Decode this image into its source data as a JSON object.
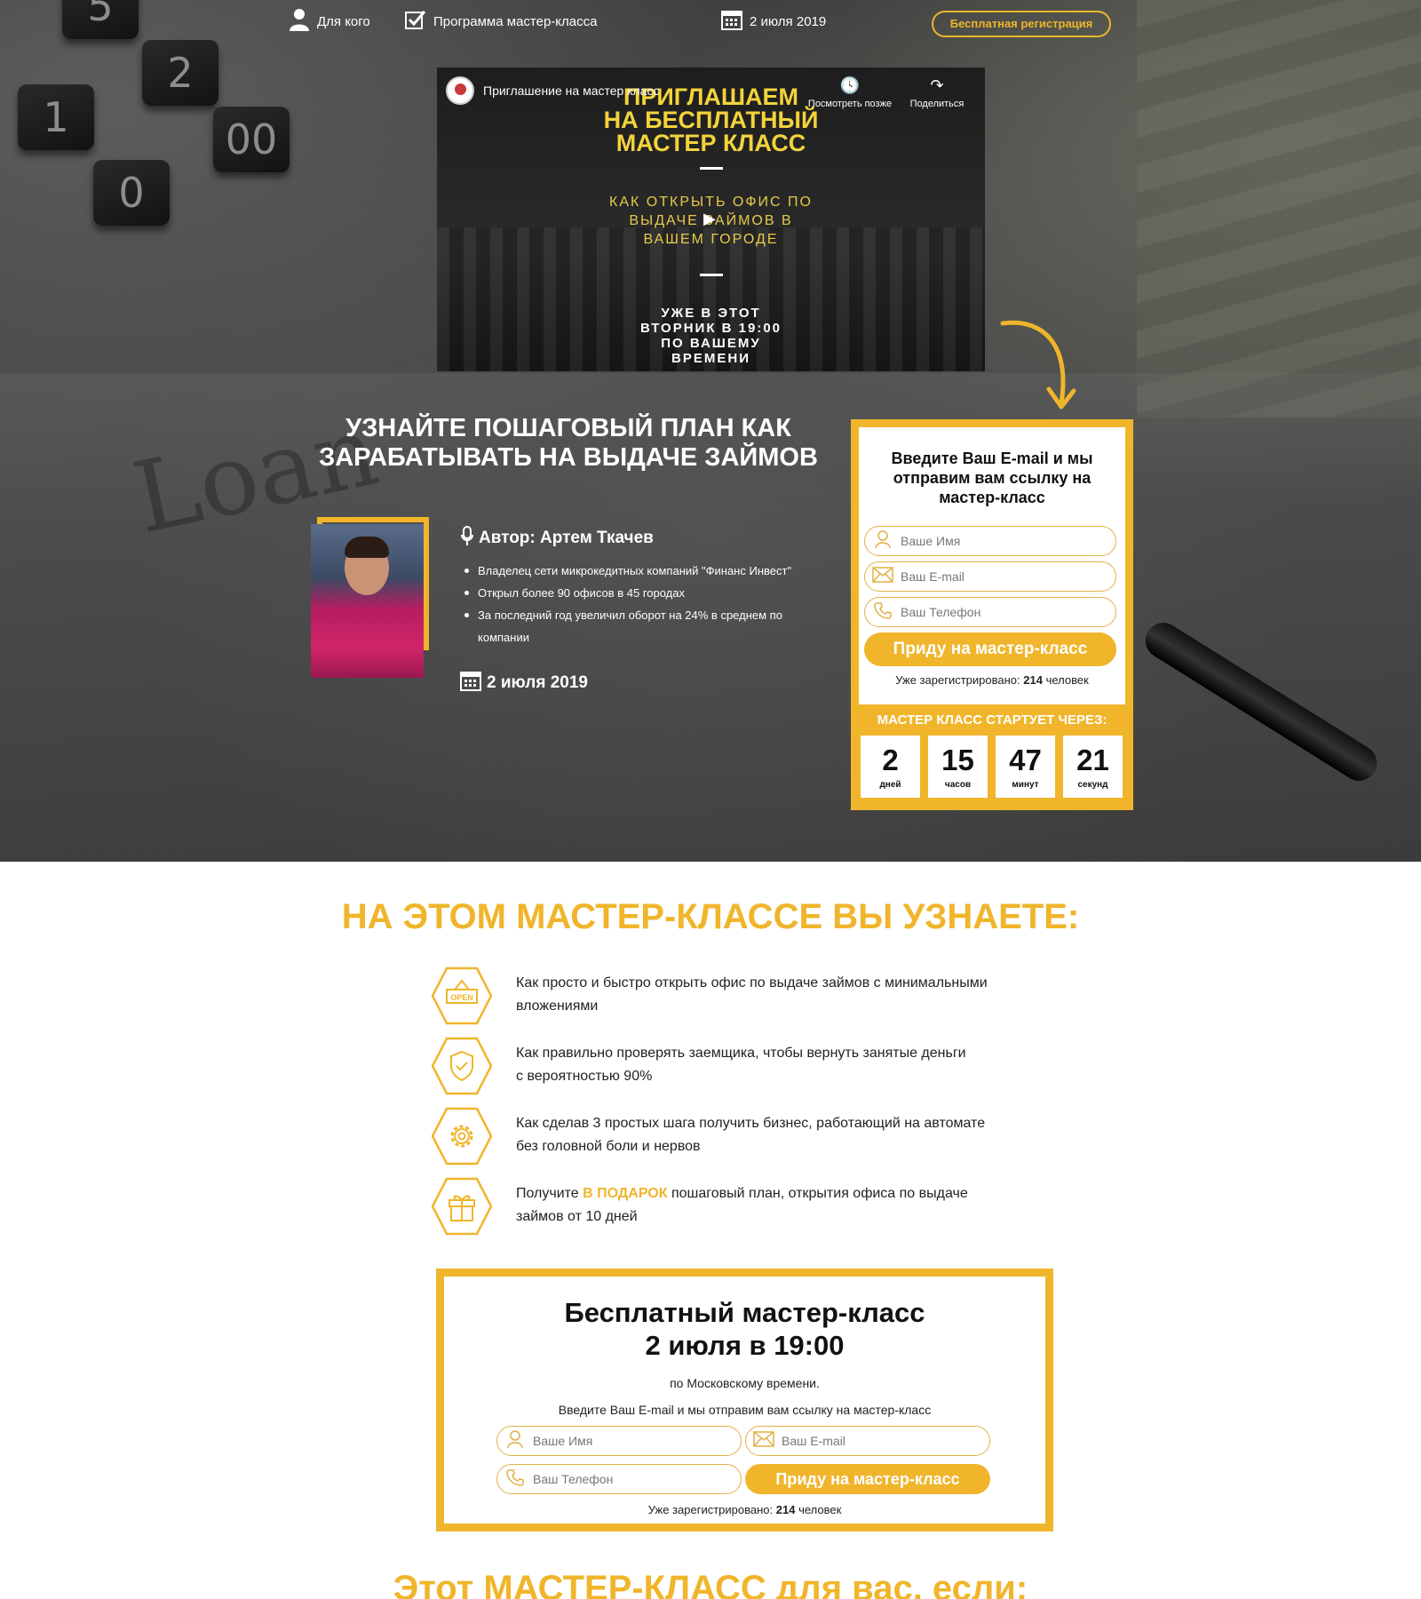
{
  "nav": {
    "who_label": "Для кого",
    "program_label": "Программа мастер-класса",
    "date_label": "2 июля 2019",
    "cta_label": "Бесплатная регистрация"
  },
  "video": {
    "title": "Приглашение на мастер класс",
    "watch_later": "Посмотреть позже",
    "share": "Поделиться",
    "headline_1": "ПРИГЛАШАЕМ",
    "headline_2": "НА БЕСПЛАТНЫЙ",
    "headline_3": "МАСТЕР КЛАСС",
    "subtitle_1": "КАК ОТКРЫТЬ ОФИС ПО",
    "subtitle_2": "ВЫДАЧЕ ЗАЙМОВ В",
    "subtitle_3": "ВАШЕМ ГОРОДЕ",
    "bottom_1": "УЖЕ В ЭТОТ",
    "bottom_2": "ВТОРНИК В 19:00",
    "bottom_3": "ПО ВАШЕМУ",
    "bottom_4": "ВРЕМЕНИ"
  },
  "hero": {
    "title_1": "УЗНАЙТЕ ПОШАГОВЫЙ ПЛАН КАК",
    "title_2": "ЗАРАБАТЫВАТЬ НА ВЫДАЧЕ ЗАЙМОВ",
    "author": "Автор: Артем Ткачев",
    "bullets": [
      "Владелец сети микрокедитных компаний \"Финанс Инвест\"",
      "Открыл более 90 офисов в 45 городах",
      "За последний год увеличил оборот на 24% в среднем по компании"
    ],
    "date": "2 июля 2019"
  },
  "reg_form": {
    "heading_1": "Введите Ваш E-mail и мы",
    "heading_2": "отправим вам ссылку на",
    "heading_3": "мастер-класс",
    "name_placeholder": "Ваше Имя",
    "email_placeholder": "Ваш E-mail",
    "phone_placeholder": "Ваш Телефон",
    "submit_label": "Приду на мастер-класс",
    "registered_prefix": "Уже зарегистрировано:",
    "registered_count": "214",
    "registered_suffix": "человек"
  },
  "countdown": {
    "label": "МАСТЕР КЛАСС СТАРТУЕТ ЧЕРЕЗ:",
    "days": "2",
    "days_unit": "дней",
    "hours": "15",
    "hours_unit": "часов",
    "minutes": "47",
    "minutes_unit": "минут",
    "seconds": "21",
    "seconds_unit": "секунд"
  },
  "learn": {
    "title": "НА ЭТОМ МАСТЕР-КЛАССЕ ВЫ УЗНАЕТЕ:",
    "items": [
      {
        "icon": "open-sign-icon",
        "line1": "Как просто и быстро открыть офис по выдаче займов с минимальными",
        "line2": "вложениями"
      },
      {
        "icon": "shield-check-icon",
        "line1": "Как правильно проверять заемщика, чтобы вернуть занятые деньги",
        "line2": "с вероятностью 90%"
      },
      {
        "icon": "gear-icon",
        "line1": "Как сделав 3 простых шага получить бизнес, работающий на автомате",
        "line2": "без головной боли и нервов"
      },
      {
        "icon": "gift-icon",
        "prefix": "Получите ",
        "highlight": "В ПОДАРОК",
        "line1": " пошаговый план, открытия офиса по выдаче",
        "line2": "займов от 10 дней"
      }
    ]
  },
  "bottom_form": {
    "title_1": "Бесплатный мастер-класс",
    "title_2": "2 июля в 19:00",
    "sub_1": "по Московскому времени.",
    "sub_2": "Введите Ваш E-mail и мы отправим вам ссылку на мастер-класс",
    "name_placeholder": "Ваше Имя",
    "email_placeholder": "Ваш E-mail",
    "phone_placeholder": "Ваш Телефон",
    "submit_label": "Приду на мастер-класс",
    "registered_prefix": "Уже зарегистрировано:",
    "registered_count": "214",
    "registered_suffix": "человек"
  },
  "next_section": {
    "title": "Этот МАСТЕР-КЛАСС для вас, если:"
  },
  "colors": {
    "accent": "#f0b52b",
    "hero_dark": "#3b3b3b"
  }
}
